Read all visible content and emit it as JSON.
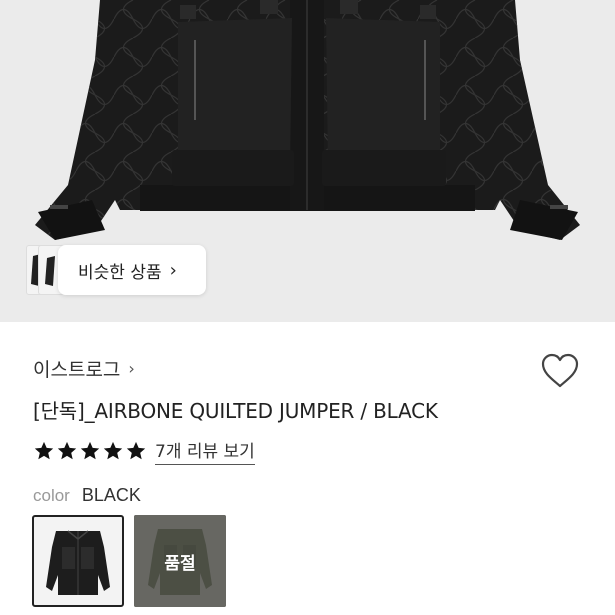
{
  "hero": {
    "image": "black quilted jacket product photo",
    "similar_button": {
      "label": "비슷한 상품",
      "icon": "chevron-right-icon"
    }
  },
  "product": {
    "brand": "이스트로그",
    "brand_icon": "chevron-right-icon",
    "title": "[단독]_AIRBONE QUILTED JUMPER / BLACK",
    "wishlist_icon": "heart-outline-icon",
    "rating": {
      "stars": 5,
      "max": 5,
      "review_link": "7개 리뷰 보기"
    },
    "color": {
      "label": "color",
      "value": "BLACK"
    },
    "swatches": [
      {
        "name": "BLACK",
        "selected": true,
        "sold_out": false
      },
      {
        "name": "OLIVE",
        "selected": false,
        "sold_out": true,
        "badge": "품절"
      }
    ]
  },
  "colors": {
    "star": "#111111",
    "background_hero": "#ebebeb",
    "selected_border": "#222222"
  }
}
